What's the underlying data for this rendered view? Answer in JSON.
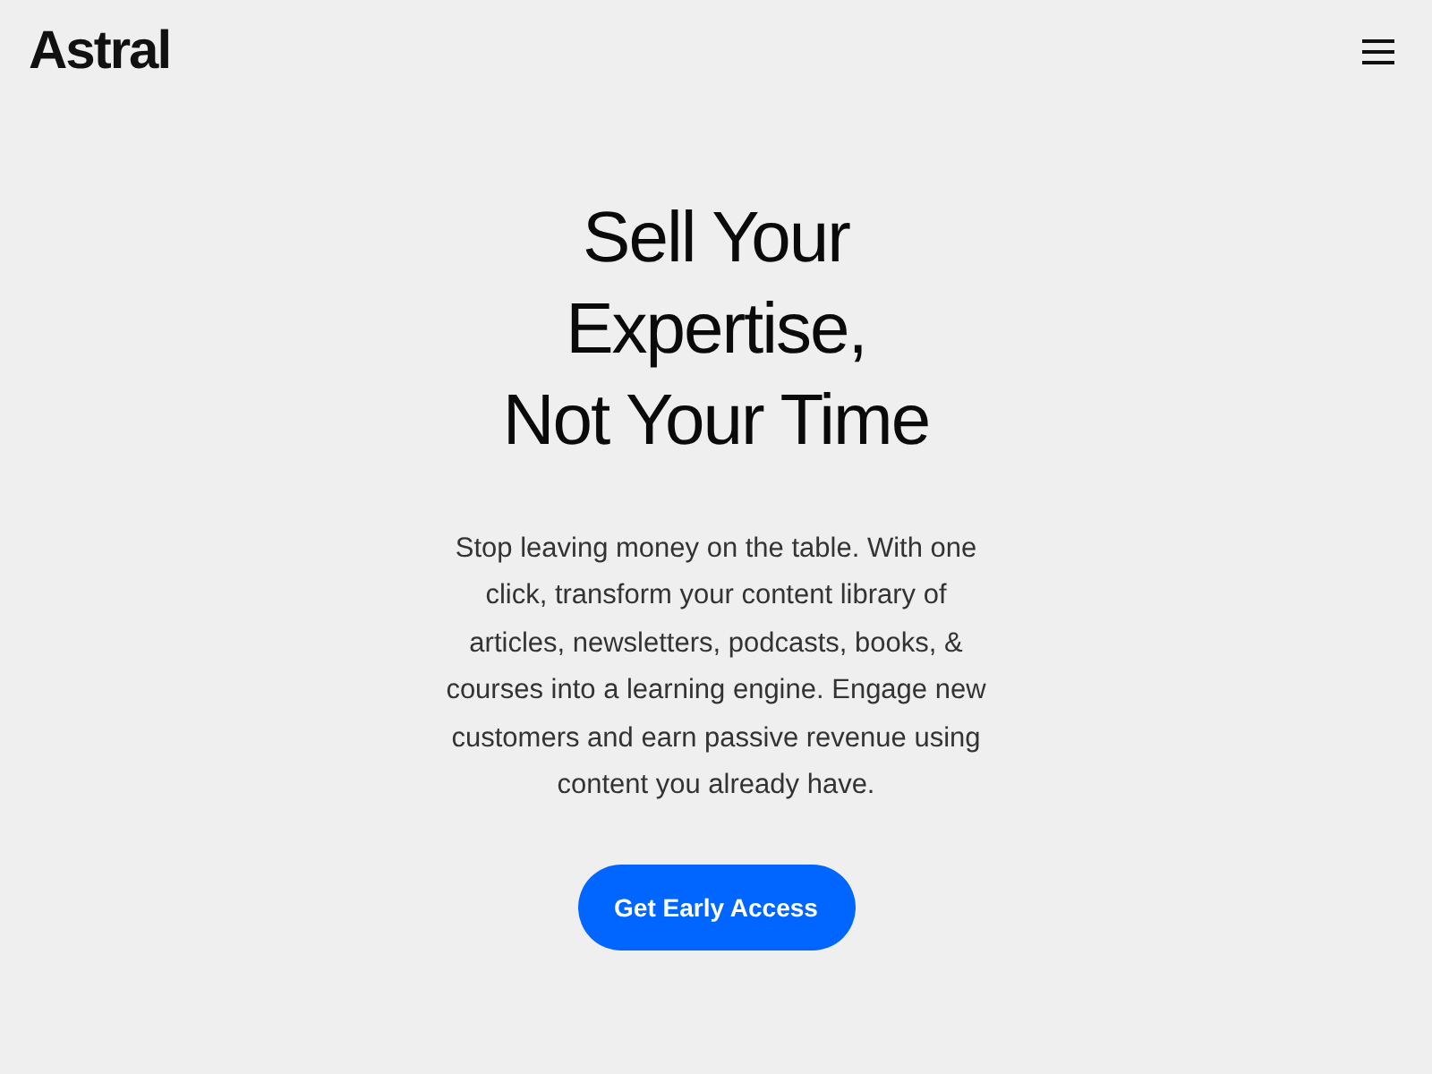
{
  "header": {
    "logo": "Astral"
  },
  "hero": {
    "headline_lines": [
      "Sell Your",
      "Expertise,",
      "Not Your Time"
    ],
    "description": "Stop leaving money on the table. With one click, transform your content library of articles, newsletters, podcasts, books, & courses into a learning engine. Engage new customers and earn passive revenue using content you already have.",
    "cta": "Get Early Access"
  }
}
